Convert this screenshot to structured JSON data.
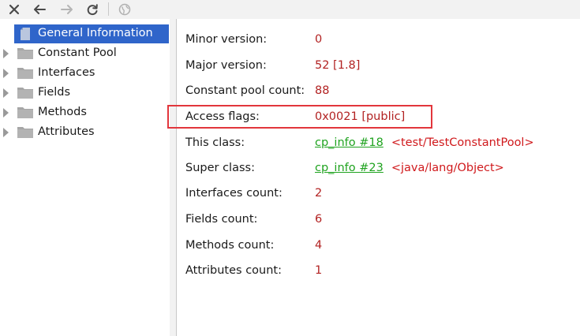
{
  "toolbar": {
    "buttons": [
      {
        "name": "close",
        "icon": "close-icon"
      },
      {
        "name": "back",
        "icon": "arrow-left-icon"
      },
      {
        "name": "forward",
        "icon": "arrow-right-icon"
      },
      {
        "name": "refresh",
        "icon": "refresh-icon"
      },
      {
        "name": "browser",
        "icon": "globe-icon"
      }
    ]
  },
  "tree": {
    "items": [
      {
        "label": "General Information",
        "icon": "file-icon",
        "selected": true
      },
      {
        "label": "Constant Pool",
        "icon": "folder-icon"
      },
      {
        "label": "Interfaces",
        "icon": "folder-icon"
      },
      {
        "label": "Fields",
        "icon": "folder-icon"
      },
      {
        "label": "Methods",
        "icon": "folder-icon"
      },
      {
        "label": "Attributes",
        "icon": "folder-icon"
      }
    ]
  },
  "info": {
    "minor_version": {
      "label": "Minor version:",
      "value": "0"
    },
    "major_version": {
      "label": "Major version:",
      "value": "52 [1.8]"
    },
    "constant_pool_count": {
      "label": "Constant pool count:",
      "value": "88"
    },
    "access_flags": {
      "label": "Access flags:",
      "value": "0x0021 [public]"
    },
    "this_class": {
      "label": "This class:",
      "link": "cp_info #18",
      "ref": "<test/TestConstantPool>"
    },
    "super_class": {
      "label": "Super class:",
      "link": "cp_info #23",
      "ref": "<java/lang/Object>"
    },
    "interfaces_count": {
      "label": "Interfaces count:",
      "value": "2"
    },
    "fields_count": {
      "label": "Fields count:",
      "value": "6"
    },
    "methods_count": {
      "label": "Methods count:",
      "value": "4"
    },
    "attributes_count": {
      "label": "Attributes count:",
      "value": "1"
    }
  },
  "colors": {
    "selection": "#2f65ca",
    "value": "#b22222",
    "link": "#1fa31f",
    "highlight_box": "#e2363c"
  }
}
